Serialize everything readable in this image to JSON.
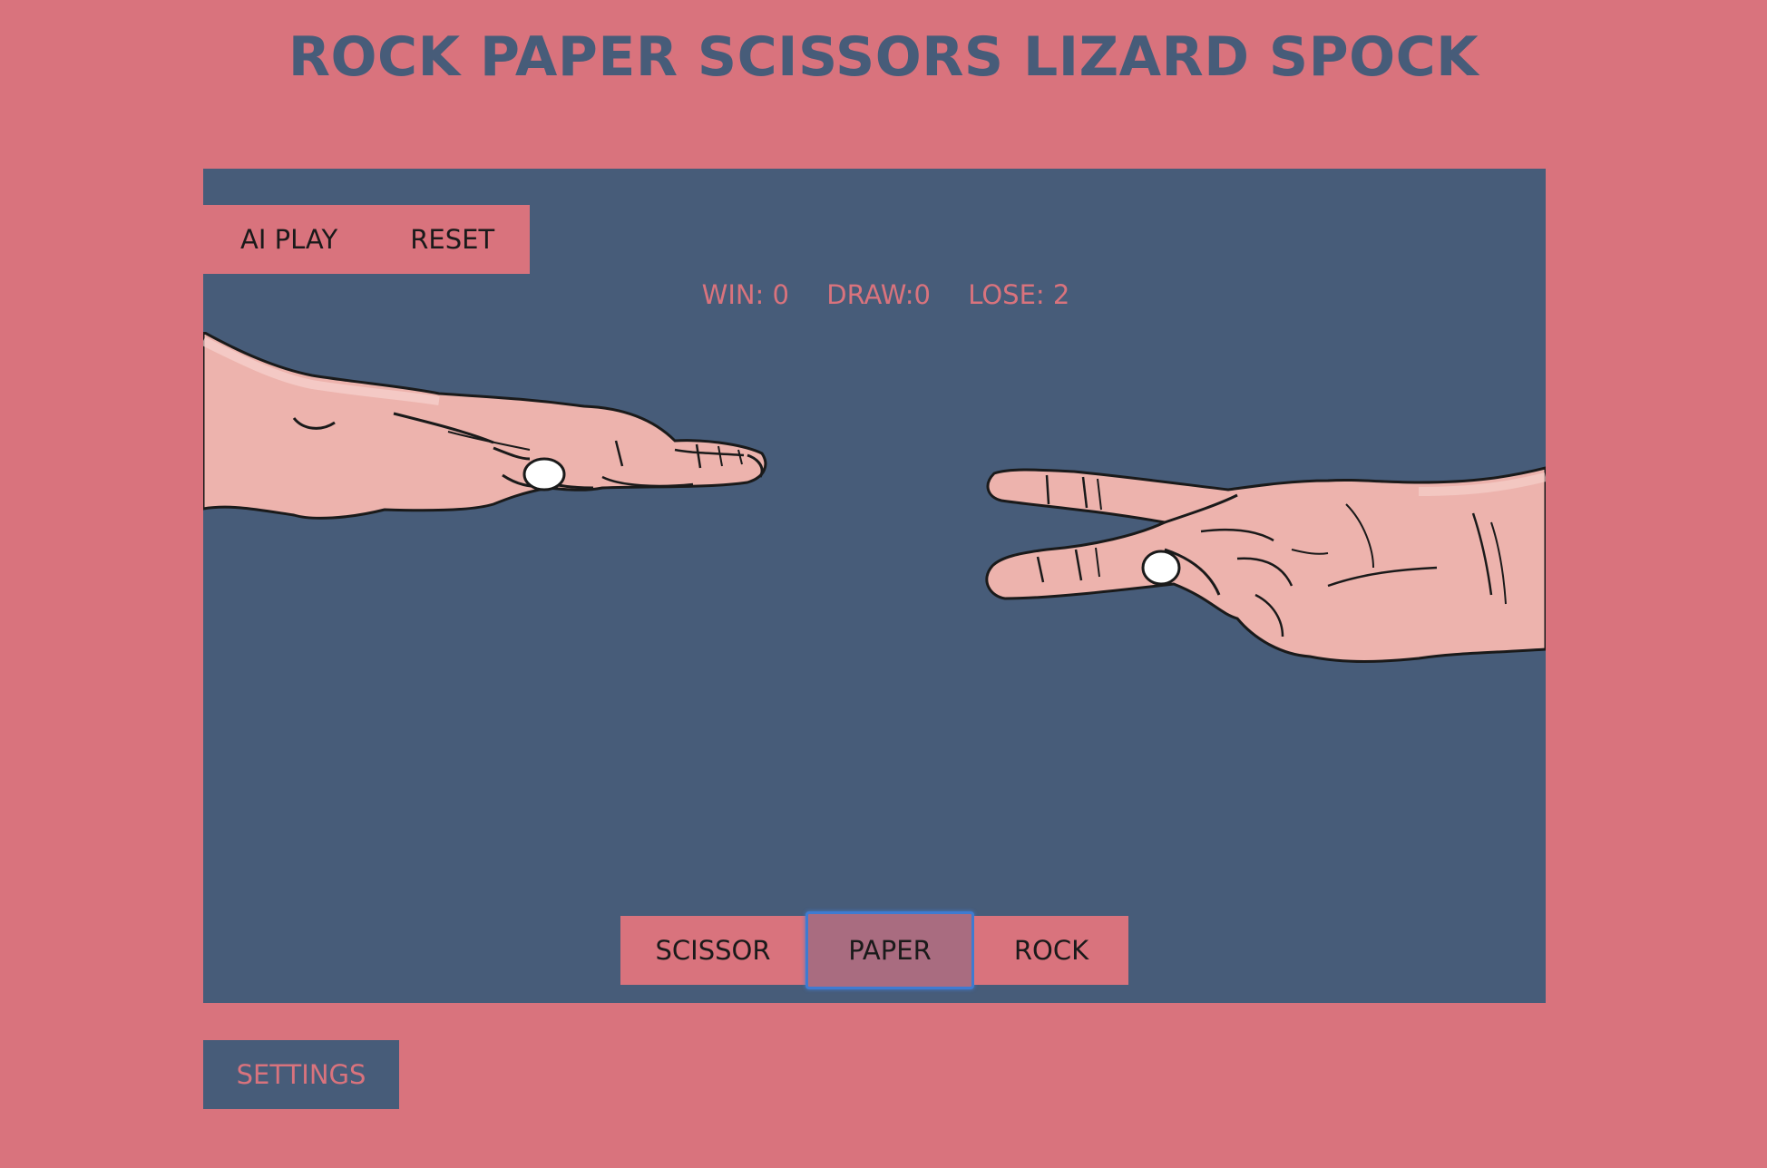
{
  "app": {
    "title": "ROCK PAPER SCISSORS LIZARD SPOCK"
  },
  "controls": {
    "ai_play_label": "AI PLAY",
    "reset_label": "RESET"
  },
  "score": {
    "win": "WIN: 0",
    "draw": "DRAW:0",
    "lose": "LOSE: 2"
  },
  "hands": {
    "player": "paper-hand",
    "opponent": "scissors-hand"
  },
  "choices": [
    {
      "label": "SCISSOR",
      "selected": false
    },
    {
      "label": "PAPER",
      "selected": true
    },
    {
      "label": "ROCK",
      "selected": false
    }
  ],
  "footer": {
    "settings_label": "SETTINGS"
  },
  "colors": {
    "background": "#d9737d",
    "stage": "#475c79",
    "skin": "#edb3ad",
    "focus_ring": "#3f7bd1"
  }
}
